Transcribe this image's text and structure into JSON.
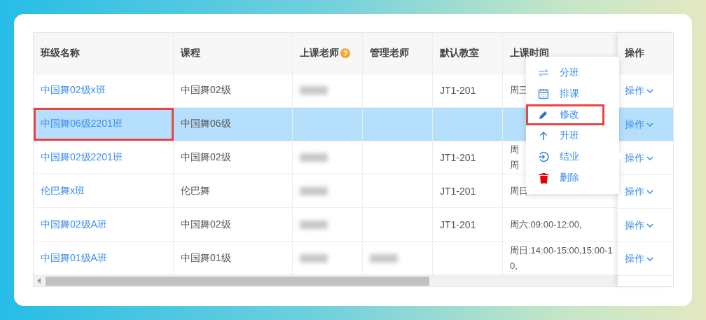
{
  "table": {
    "columns": [
      {
        "label": "班级名称"
      },
      {
        "label": "课程"
      },
      {
        "label": "上课老师",
        "help": "?"
      },
      {
        "label": "管理老师"
      },
      {
        "label": "默认教室"
      },
      {
        "label": "上课时间"
      }
    ],
    "action_column": {
      "label": "操作"
    },
    "rows": [
      {
        "name": "中国舞02级x班",
        "course": "中国舞02级",
        "teacher_redacted": true,
        "manager_redacted": false,
        "room": "JT1-201",
        "time": [
          "周三"
        ],
        "action": "操作",
        "selected": false,
        "highlighted": false
      },
      {
        "name": "中国舞06级2201班",
        "course": "中国舞06级",
        "teacher_redacted": false,
        "manager_redacted": false,
        "room": "",
        "time": [],
        "action": "操作",
        "selected": true,
        "highlighted": true
      },
      {
        "name": "中国舞02级2201班",
        "course": "中国舞02级",
        "teacher_redacted": true,
        "manager_redacted": false,
        "room": "JT1-201",
        "time": [
          "周",
          "周"
        ],
        "action": "操作",
        "selected": false,
        "highlighted": false
      },
      {
        "name": "伦巴舞x班",
        "course": "伦巴舞",
        "teacher_redacted": true,
        "manager_redacted": false,
        "room": "JT1-201",
        "time": [
          "周日"
        ],
        "action": "操作",
        "selected": false,
        "highlighted": false
      },
      {
        "name": "中国舞02级A班",
        "course": "中国舞02级",
        "teacher_redacted": true,
        "manager_redacted": false,
        "room": "JT1-201",
        "time": [
          "周六:09:00-12:00,"
        ],
        "action": "操作",
        "selected": false,
        "highlighted": false
      },
      {
        "name": "中国舞01级A班",
        "course": "中国舞01级",
        "teacher_redacted": true,
        "manager_redacted": true,
        "room": "",
        "time": [
          "周日:14:00-15:00,15:00-1",
          "0,"
        ],
        "action": "操作",
        "selected": false,
        "highlighted": false
      }
    ]
  },
  "action_menu": {
    "items": [
      {
        "kind": "split",
        "label": "分班",
        "highlighted": false
      },
      {
        "kind": "schedule",
        "label": "排课",
        "highlighted": false
      },
      {
        "kind": "edit",
        "label": "修改",
        "highlighted": true
      },
      {
        "kind": "promote",
        "label": "升班",
        "highlighted": false
      },
      {
        "kind": "graduate",
        "label": "结业",
        "highlighted": false
      },
      {
        "kind": "delete",
        "label": "删除",
        "highlighted": false
      }
    ]
  }
}
